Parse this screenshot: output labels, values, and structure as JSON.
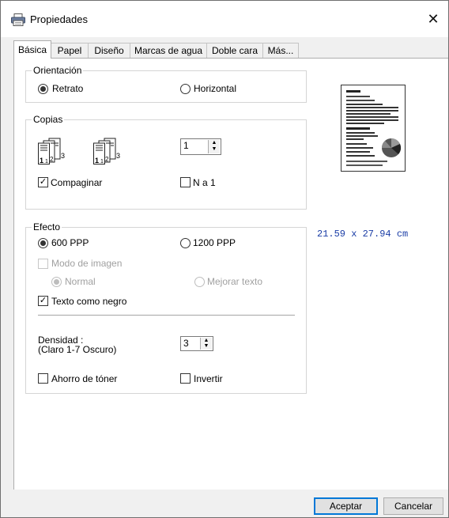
{
  "window": {
    "title": "Propiedades",
    "close_glyph": "✕",
    "icon": "printer-icon"
  },
  "tabs": [
    {
      "label": "Básica",
      "active": true
    },
    {
      "label": "Papel",
      "active": false
    },
    {
      "label": "Diseño",
      "active": false
    },
    {
      "label": "Marcas de agua",
      "active": false
    },
    {
      "label": "Doble cara",
      "active": false
    },
    {
      "label": "Más...",
      "active": false
    }
  ],
  "orientation": {
    "legend": "Orientación",
    "portrait_label": "Retrato",
    "landscape_label": "Horizontal",
    "selected": "portrait"
  },
  "copies": {
    "legend": "Copias",
    "value": "1",
    "collate_label": "Compaginar",
    "collate_checked": true,
    "n_in_1_label": "N a 1",
    "n_in_1_checked": false,
    "icon_page_numbers": [
      "1",
      "2",
      "3"
    ]
  },
  "effect": {
    "legend": "Efecto",
    "dpi600_label": "600 PPP",
    "dpi1200_label": "1200 PPP",
    "selected_dpi": "600",
    "image_mode_label": "Modo de imagen",
    "image_mode_checked": false,
    "normal_label": "Normal",
    "enhance_text_label": "Mejorar texto",
    "text_as_black_label": "Texto como negro",
    "text_as_black_checked": true,
    "density_label_line1": "Densidad :",
    "density_label_line2": "(Claro 1-7 Oscuro)",
    "density_value": "3",
    "toner_save_label": "Ahorro de tóner",
    "toner_save_checked": false,
    "invert_label": "Invertir",
    "invert_checked": false
  },
  "preview": {
    "paper_size": "21.59 x 27.94 cm"
  },
  "buttons": {
    "ok": "Aceptar",
    "cancel": "Cancelar"
  },
  "colors": {
    "accent": "#0078d7",
    "paper_size_text": "#1a3da6",
    "dialog_bg": "#f0f0f0"
  }
}
